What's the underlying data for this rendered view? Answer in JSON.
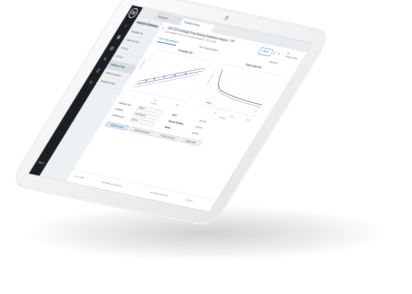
{
  "app": {
    "logo": "GE",
    "rail_items": [
      {
        "icon": "home-icon",
        "glyph": "⌂",
        "label": ""
      },
      {
        "icon": "grid-icon",
        "glyph": "▦",
        "label": ""
      },
      {
        "icon": "chart-icon",
        "glyph": "▤",
        "label": ""
      },
      {
        "icon": "tools-icon",
        "glyph": "✎",
        "label": ""
      },
      {
        "icon": "list-icon",
        "glyph": "☰",
        "label": ""
      },
      {
        "icon": "folder-icon",
        "glyph": "▭",
        "label": ""
      }
    ],
    "signout": "Sign out"
  },
  "tabs": [
    {
      "label": "Dashboard"
    },
    {
      "label": "Reliability Analytics"
    }
  ],
  "nav": {
    "title": "Analysis Summary",
    "items": [
      {
        "label": "Probability Plot"
      },
      {
        "label": "Failure Rate Plot"
      },
      {
        "label": "PDF Plot"
      },
      {
        "label": "CDF Plot"
      },
      {
        "label": "Distribution Fitting"
      },
      {
        "label": "Weibull Parameters"
      },
      {
        "label": "Distribution Details"
      }
    ]
  },
  "header": {
    "title": "1051720 Centrifugal Pump Bearing Distribution Analysis - TTF",
    "subtitle": "Last modified by CCUSCCA on Thursday, November 16, 2017 9:37 AM",
    "report_button": "Report",
    "tool_icons": "⎙ ✎ ⋯",
    "user_line1": "Site",
    "user_line2": "Hideaway_Testing"
  },
  "subtabs": [
    {
      "label": "Time to Failure Distribution"
    },
    {
      "label": "Time to Repair Distribution"
    },
    {
      "label": "Failure Data"
    }
  ],
  "plots": {
    "left": {
      "title": "Probability Plot",
      "ylabel": "Unreliability",
      "xlabel": "TTF (Days)",
      "xticks": [
        "1",
        "100",
        "1000"
      ]
    },
    "right": {
      "title": "Failure Rate Plot",
      "ylabel": "Failure Rate",
      "xlabel": "TTF (Days)",
      "xticks": [
        "0",
        "500",
        "1000",
        "1500"
      ]
    }
  },
  "params": {
    "dist_type_label": "Distribution Type",
    "dist_type_value": "Weibull",
    "fit_method_label": "Fit Method",
    "fit_method_value": "Least Squares",
    "confidence_label": "Confidence Level",
    "confidence_value": "90.00 %",
    "mttf_label": "MTTF",
    "std_dev_label": "Standard Deviation",
    "median_label": "Median",
    "values": [
      "260.7553",
      "312.4216",
      "198.5540"
    ],
    "buttons": {
      "distribution": "Distribution Options",
      "parameters": "Distribution Parameters",
      "goodness": "Goodness of Fit Tests",
      "analysis": "Analysis Dates"
    }
  },
  "footer": {
    "left": "2.4.0.1.178309",
    "mid": "apmreliability.apm.ge.predix.io",
    "right1": "Jarrett Mills-Admin-Testing",
    "right2": "CL0987654"
  }
}
